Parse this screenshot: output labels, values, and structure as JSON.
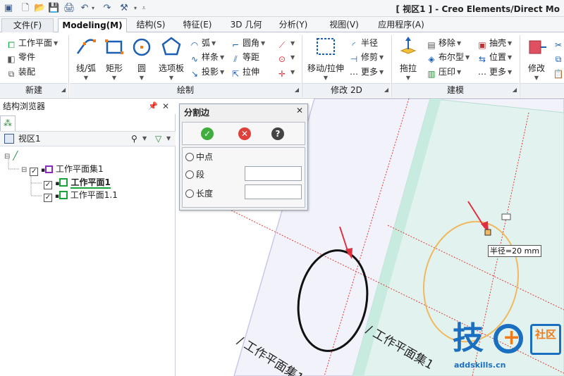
{
  "window": {
    "title": "[ 视区1 ] - Creo Elements/Direct Mo"
  },
  "tabs": [
    {
      "label": "文件(F)"
    },
    {
      "label": "Modeling(M)"
    },
    {
      "label": "结构(S)"
    },
    {
      "label": "特征(E)"
    },
    {
      "label": "3D 几何"
    },
    {
      "label": "分析(Y)"
    },
    {
      "label": "视图(V)"
    },
    {
      "label": "应用程序(A)"
    }
  ],
  "ribbon": {
    "new_group": {
      "label": "新建",
      "items": [
        "工作平面",
        "零件",
        "装配"
      ]
    },
    "draw_group": {
      "label": "绘制",
      "big": [
        "线/弧",
        "矩形",
        "圆",
        "选项板"
      ],
      "small_a": [
        "弧",
        "样条",
        "投影"
      ],
      "small_b": [
        "圆角",
        "等距",
        "拉伸"
      ]
    },
    "modify_group": {
      "label": "修改 2D",
      "big": "移动/拉伸",
      "items": [
        "半径",
        "修剪",
        "更多"
      ]
    },
    "model_group": {
      "label": "建模",
      "big": "拖拉",
      "small_a": [
        "移除",
        "布尔型",
        "压印"
      ],
      "small_b": [
        "抽壳",
        "位置",
        "更多"
      ]
    },
    "edit": {
      "big": "修改"
    }
  },
  "browser": {
    "title": "结构浏览器",
    "view_label": "视区1",
    "tree": [
      "工作平面集1",
      "工作平面1",
      "工作平面1.1"
    ]
  },
  "dialog": {
    "title": "分割边",
    "options": [
      "中点",
      "段",
      "长度"
    ]
  },
  "canvas": {
    "tooltip": "半径=20 mm",
    "plane_label_a": "/ 工作平面集1",
    "plane_label_b": "/ 工作平面集1"
  },
  "watermark": {
    "brand_a": "技",
    "brand_b": "社区",
    "url": "addskills.cn"
  },
  "colors": {
    "accent": "#2f6fb6",
    "plane_fill": "#e2f3ef",
    "highlight": "#f0b860",
    "arrow": "#e03040",
    "logo": "#1b6fc0",
    "logo_accent": "#ef7b1a"
  }
}
